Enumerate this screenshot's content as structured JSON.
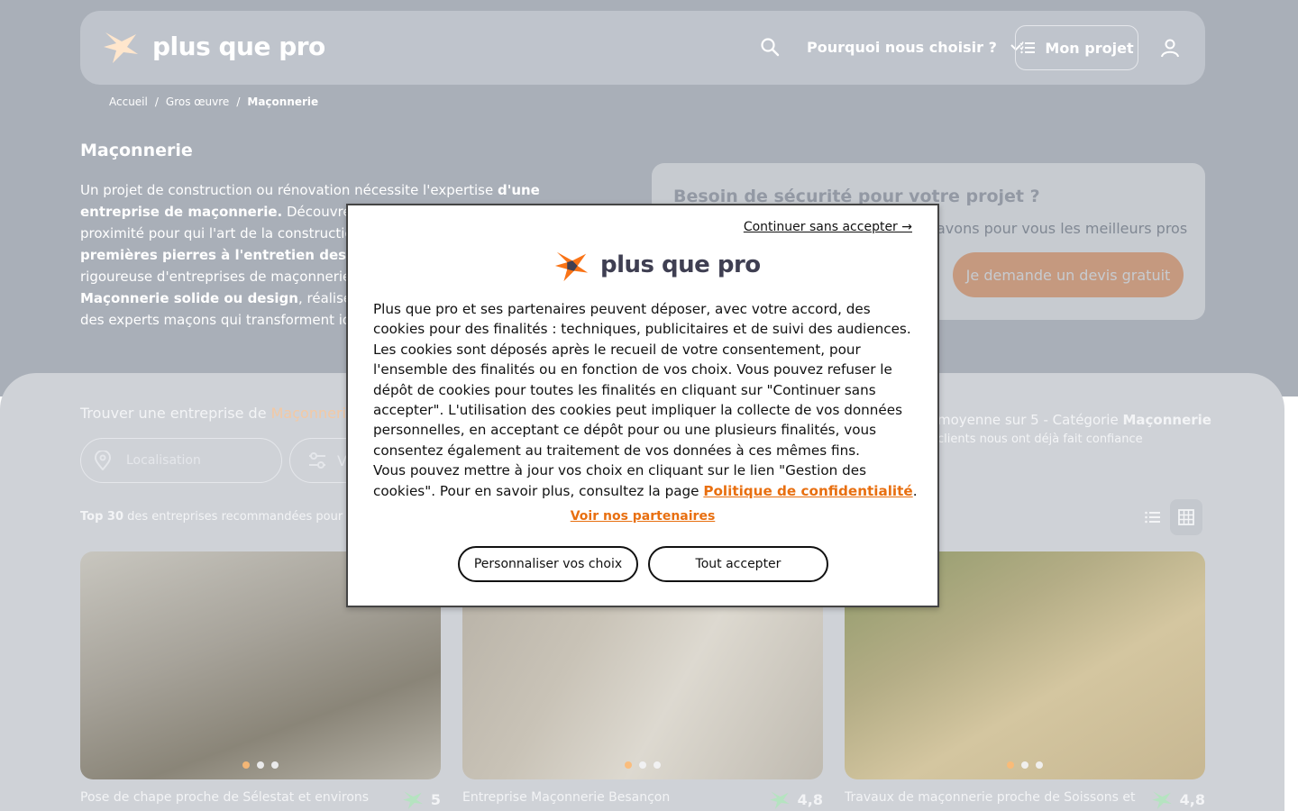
{
  "header": {
    "logo_text": "plus que pro",
    "nav_why": "Pourquoi nous choisir ?",
    "nav_project": "Mon projet"
  },
  "breadcrumb": {
    "home": "Accueil",
    "sep": "/",
    "parent": "Gros œuvre",
    "current": "Maçonnerie"
  },
  "hero": {
    "title": "Maçonnerie",
    "desc_1": "Un projet de construction ou rénovation nécessite l'expertise ",
    "desc_bold_1": "d'une entreprise de maçonnerie.",
    "desc_2": " Découvrez nos adhérents",
    "desc_3": "proximité pour qui l'art de la construction",
    "desc_bold_2": "premières pierres à l'entretien des fini",
    "desc_4": "rigoureuse d'entreprises de maçonnerie",
    "desc_bold_3": "Maçonnerie solide ou design",
    "desc_5": ", réalisez",
    "desc_6": "des experts maçons qui transforment id"
  },
  "side_card": {
    "title": "Besoin de sécurité pour votre projet ?",
    "subtitle": "avons pour vous les meilleurs pros",
    "cta": "Je demande un devis gratuit"
  },
  "search": {
    "title_prefix": "Trouver une entreprise de ",
    "title_accent": "Maçonnerie",
    "location_placeholder": "Localisation",
    "filter_label": "V"
  },
  "rating": {
    "line": "moyenne sur 5 - Catégorie ",
    "category": "Maçonnerie",
    "trust": "clients nous ont déjà fait confiance"
  },
  "list": {
    "top_bold": "Top 30",
    "top_text": " des entreprises recommandées pour"
  },
  "cards": [
    {
      "name": "Pose de chape proche de Sélestat et environs",
      "rating": "5"
    },
    {
      "name": "Entreprise Maçonnerie Besançon",
      "rating": "4,8"
    },
    {
      "name": "Travaux de maçonnerie proche de Soissons et",
      "rating": "4,8"
    }
  ],
  "cookie": {
    "skip": "Continuer sans accepter →",
    "logo_text": "plus que pro",
    "body_1": "Plus que pro et ses partenaires peuvent déposer, avec votre accord, des cookies pour des finalités : techniques, publicitaires et de suivi des audiences. Les cookies sont déposés après le recueil de votre consentement, pour l'ensemble des finalités ou en fonction de vos choix. Vous pouvez refuser le dépôt de cookies pour toutes les finalités en cliquant sur \"Continuer sans accepter\". L'utilisation des cookies peut impliquer la collecte de vos données personnelles, en acceptant ce dépôt pour ou une plusieurs finalités, vous consentez également au traitement de vos données à ces mêmes fins.",
    "body_2": "Vous pouvez mettre à jour vos choix en cliquant sur le lien \"Gestion des cookies\". Pour en savoir plus, consultez la page ",
    "policy_link": "Politique de confidentialité",
    "body_end": ".",
    "partners": "Voir nos partenaires",
    "btn_custom": "Personnaliser vos choix",
    "btn_accept": "Tout accepter"
  },
  "colors": {
    "brand_orange": "#f97316",
    "link_orange": "#e86f10",
    "logo_dark": "#3f3f52"
  }
}
